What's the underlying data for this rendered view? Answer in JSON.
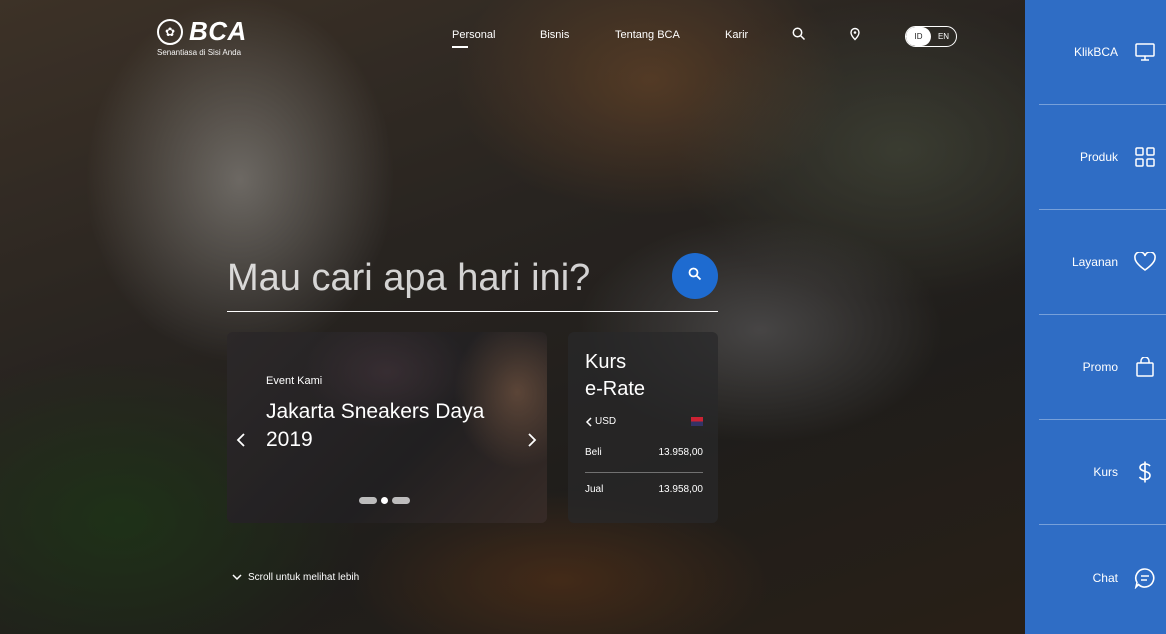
{
  "brand": {
    "name": "BCA",
    "tagline": "Senantiasa di Sisi Anda"
  },
  "nav": [
    {
      "label": "Personal",
      "active": true
    },
    {
      "label": "Bisnis",
      "active": false
    },
    {
      "label": "Tentang BCA",
      "active": false
    },
    {
      "label": "Karir",
      "active": false
    }
  ],
  "icons": {
    "search": "search-icon",
    "location": "location-pin-icon"
  },
  "language": {
    "options": [
      "ID",
      "EN"
    ],
    "selected": "ID"
  },
  "search": {
    "placeholder": "Mau cari apa hari ini?"
  },
  "event": {
    "kicker": "Event Kami",
    "title": "Jakarta Sneakers Daya 2019",
    "slides_total": 3,
    "slide_selected": 2
  },
  "kurs": {
    "title_line1": "Kurs",
    "title_line2": "e-Rate",
    "currency": "USD",
    "rows": [
      {
        "label": "Beli",
        "value": "13.958,00"
      },
      {
        "label": "Jual",
        "value": "13.958,00"
      }
    ]
  },
  "scroll_hint": "Scroll untuk melihat lebih",
  "sidebar": [
    {
      "label": "KlikBCA",
      "icon": "monitor-icon"
    },
    {
      "label": "Produk",
      "icon": "grid-icon"
    },
    {
      "label": "Layanan",
      "icon": "heart-icon"
    },
    {
      "label": "Promo",
      "icon": "bag-icon"
    },
    {
      "label": "Kurs",
      "icon": "dollar-icon"
    },
    {
      "label": "Chat",
      "icon": "chat-icon"
    }
  ],
  "colors": {
    "accent": "#1e6bd0",
    "sidebar": "#2f6dc5"
  }
}
